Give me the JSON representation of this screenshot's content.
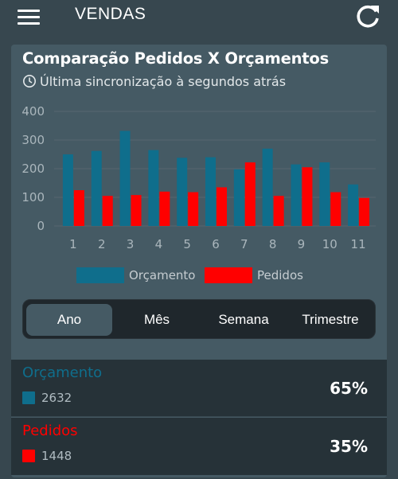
{
  "header": {
    "title": "VENDAS",
    "menu_icon": "menu-icon",
    "refresh_icon": "refresh-icon"
  },
  "card": {
    "title": "Comparação Pedidos X Orçamentos",
    "sync_text": "Última sincronização à segundos atrás",
    "sync_icon": "clock-icon"
  },
  "colors": {
    "orcamento": "#0f6e8c",
    "pedidos": "#ff0000",
    "background": "#37474f",
    "card": "#455a64",
    "panel": "#263238"
  },
  "chart_data": {
    "type": "bar",
    "categories": [
      "1",
      "2",
      "3",
      "4",
      "5",
      "6",
      "7",
      "8",
      "9",
      "10",
      "11"
    ],
    "series": [
      {
        "name": "Orçamento",
        "color": "#0f6e8c",
        "values": [
          250,
          262,
          332,
          265,
          238,
          240,
          198,
          270,
          215,
          222,
          145
        ]
      },
      {
        "name": "Pedidos",
        "color": "#ff0000",
        "values": [
          125,
          105,
          108,
          120,
          118,
          135,
          222,
          105,
          205,
          118,
          98
        ]
      }
    ],
    "yticks": [
      0,
      100,
      200,
      300,
      400
    ],
    "ylim": [
      0,
      400
    ],
    "grid": true,
    "legend": "bottom-center"
  },
  "periods": {
    "items": [
      "Ano",
      "Mês",
      "Semana",
      "Trimestre"
    ],
    "selected": "Ano"
  },
  "summary": [
    {
      "label": "Orçamento",
      "count": "2632",
      "percent": "65%",
      "color": "#0f6e8c"
    },
    {
      "label": "Pedidos",
      "count": "1448",
      "percent": "35%",
      "color": "#ff0000"
    }
  ]
}
